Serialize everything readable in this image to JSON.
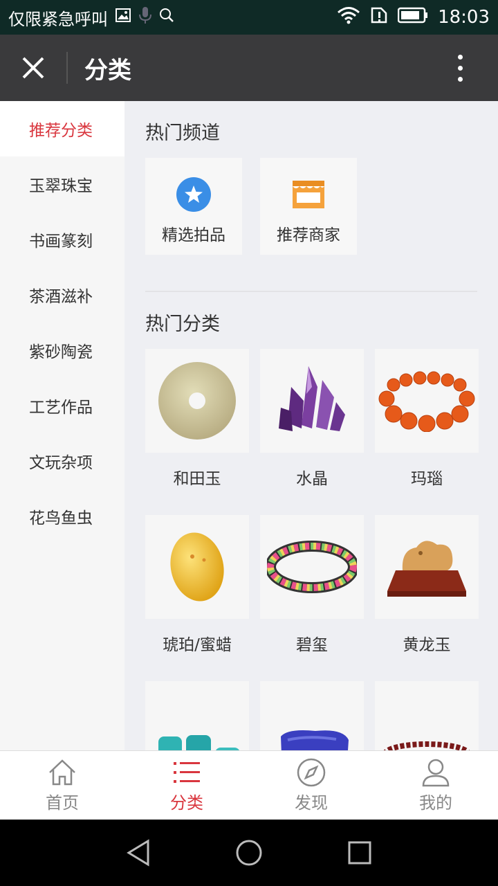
{
  "status_bar": {
    "notification_text": "仅限紧急呼叫",
    "time": "18:03"
  },
  "header": {
    "title": "分类"
  },
  "sidebar": {
    "items": [
      {
        "label": "推荐分类",
        "active": true
      },
      {
        "label": "玉翠珠宝"
      },
      {
        "label": "书画篆刻"
      },
      {
        "label": "茶酒滋补"
      },
      {
        "label": "紫砂陶瓷"
      },
      {
        "label": "工艺作品"
      },
      {
        "label": "文玩杂项"
      },
      {
        "label": "花鸟鱼虫"
      }
    ]
  },
  "main": {
    "hot_channels_title": "热门频道",
    "channels": [
      {
        "label": "精选拍品",
        "icon": "star-badge-icon"
      },
      {
        "label": "推荐商家",
        "icon": "shop-icon"
      }
    ],
    "hot_categories_title": "热门分类",
    "categories": [
      {
        "label": "和田玉",
        "icon": "jade-disc-icon"
      },
      {
        "label": "水晶",
        "icon": "crystal-icon"
      },
      {
        "label": "玛瑙",
        "icon": "agate-bracelet-icon"
      },
      {
        "label": "琥珀/蜜蜡",
        "icon": "amber-icon"
      },
      {
        "label": "碧玺",
        "icon": "tourmaline-bracelet-icon"
      },
      {
        "label": "黄龙玉",
        "icon": "carving-icon"
      },
      {
        "label": "",
        "icon": "turquoise-icon"
      },
      {
        "label": "",
        "icon": "lapis-icon"
      },
      {
        "label": "",
        "icon": "garnet-bracelet-icon"
      }
    ]
  },
  "tabbar": {
    "tabs": [
      {
        "label": "首页",
        "icon": "home-icon"
      },
      {
        "label": "分类",
        "icon": "list-icon",
        "active": true
      },
      {
        "label": "发现",
        "icon": "compass-icon"
      },
      {
        "label": "我的",
        "icon": "user-icon"
      }
    ]
  },
  "colors": {
    "accent": "#d9363e",
    "header_bg": "#3a3a3c",
    "status_bg": "#0f2a26",
    "channel_blue": "#3a8ee6",
    "channel_orange": "#f5a23c"
  }
}
